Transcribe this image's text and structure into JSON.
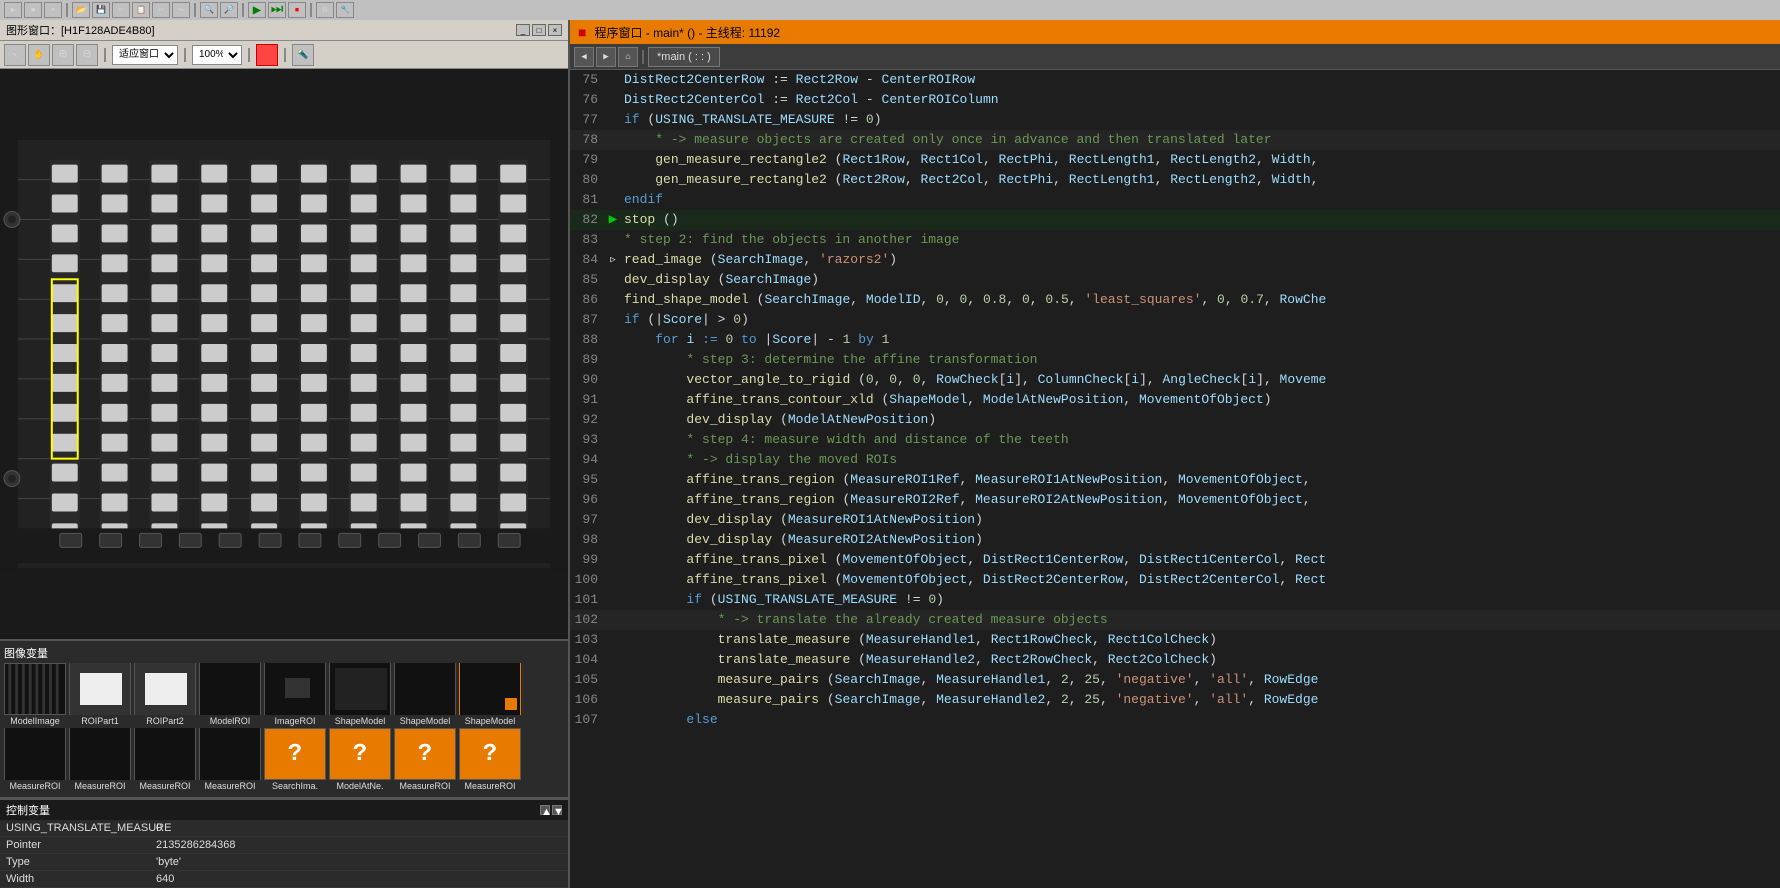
{
  "topToolbar": {
    "icons": [
      "▶",
      "⏹",
      "⏸",
      "📁",
      "💾",
      "✂",
      "📋",
      "↩",
      "↪",
      "🔍",
      "🔎",
      "⚙",
      "🔧"
    ]
  },
  "leftPanel": {
    "title": "图形窗口：[H1F128ADE4B80]",
    "toolbar": {
      "zoomLabel": "适应窗口",
      "zoomPercent": "100%"
    },
    "thumbnailSection": {
      "label": "图像变量",
      "row1": [
        {
          "label": "ModelImage",
          "type": "striped"
        },
        {
          "label": "ROIPart1",
          "type": "white"
        },
        {
          "label": "ROIPart2",
          "type": "white"
        },
        {
          "label": "ModelROI",
          "type": "dark"
        },
        {
          "label": "ImageROI",
          "type": "dark"
        },
        {
          "label": "ShapeModel",
          "type": "dark"
        },
        {
          "label": "ShapeModel",
          "type": "dark"
        },
        {
          "label": "ShapeModel",
          "type": "dark-orange"
        }
      ],
      "row2": [
        {
          "label": "MeasureROI",
          "type": "dark"
        },
        {
          "label": "MeasureROI",
          "type": "dark"
        },
        {
          "label": "MeasureROI",
          "type": "dark"
        },
        {
          "label": "MeasureROI",
          "type": "dark"
        },
        {
          "label": "SearchIma.",
          "type": "question"
        },
        {
          "label": "ModelAtNe.",
          "type": "question"
        },
        {
          "label": "MeasureROI",
          "type": "question"
        },
        {
          "label": "MeasureROI",
          "type": "question"
        }
      ]
    },
    "variablesSection": {
      "label": "控制变量",
      "rows": [
        {
          "name": "USING_TRANSLATE_MEASURE",
          "value": "0"
        },
        {
          "name": "Pointer",
          "value": "2135286284368"
        },
        {
          "name": "Type",
          "value": "'byte'"
        },
        {
          "name": "Width",
          "value": "640"
        }
      ]
    }
  },
  "rightPanel": {
    "title": "程序窗口 - main* () - 主线程: 11192",
    "breadcrumb": "*main ( : : )",
    "lines": [
      {
        "num": 75,
        "indent": 0,
        "content": "DistRect2CenterRow := Rect2Row - CenterROIRow",
        "indicator": ""
      },
      {
        "num": 76,
        "indent": 0,
        "content": "DistRect2CenterCol := Rect2Col - CenterROIColumn",
        "indicator": ""
      },
      {
        "num": 77,
        "indent": 0,
        "content": "if (USING_TRANSLATE_MEASURE != 0)",
        "indicator": ""
      },
      {
        "num": 78,
        "indent": 1,
        "content": "* -> measure objects are created only once in advance and then translated later",
        "indicator": "",
        "isComment": true
      },
      {
        "num": 79,
        "indent": 1,
        "content": "gen_measure_rectangle2 (Rect1Row, Rect1Col, RectPhi, RectLength1, RectLength2, Width,",
        "indicator": ""
      },
      {
        "num": 80,
        "indent": 1,
        "content": "gen_measure_rectangle2 (Rect2Row, Rect2Col, RectPhi, RectLength1, RectLength2, Width,",
        "indicator": ""
      },
      {
        "num": 81,
        "indent": 0,
        "content": "endif",
        "indicator": ""
      },
      {
        "num": 82,
        "indent": 0,
        "content": "stop ()",
        "indicator": "green-arrow"
      },
      {
        "num": 83,
        "indent": 0,
        "content": "* step 2: find the objects in another image",
        "indicator": "",
        "isComment": true
      },
      {
        "num": 84,
        "indent": 0,
        "content": "read_image (SearchImage, 'razors2')",
        "indicator": "",
        "hasCursor": true
      },
      {
        "num": 85,
        "indent": 0,
        "content": "dev_display (SearchImage)",
        "indicator": ""
      },
      {
        "num": 86,
        "indent": 0,
        "content": "find_shape_model (SearchImage, ModelID, 0, 0, 0.8, 0, 0.5, 'least_squares', 0, 0.7, RowChe",
        "indicator": ""
      },
      {
        "num": 87,
        "indent": 0,
        "content": "if (|Score| > 0)",
        "indicator": ""
      },
      {
        "num": 88,
        "indent": 1,
        "content": "for i := 0 to |Score| - 1 by 1",
        "indicator": ""
      },
      {
        "num": 89,
        "indent": 2,
        "content": "* step 3: determine the affine transformation",
        "indicator": "",
        "isComment": true
      },
      {
        "num": 90,
        "indent": 2,
        "content": "vector_angle_to_rigid (0, 0, 0, RowCheck[i], ColumnCheck[i], AngleCheck[i], Moveme",
        "indicator": ""
      },
      {
        "num": 91,
        "indent": 2,
        "content": "affine_trans_contour_xld (ShapeModel, ModelAtNewPosition, MovementOfObject)",
        "indicator": ""
      },
      {
        "num": 92,
        "indent": 2,
        "content": "dev_display (ModelAtNewPosition)",
        "indicator": ""
      },
      {
        "num": 93,
        "indent": 2,
        "content": "* step 4: measure width and distance of the teeth",
        "indicator": "",
        "isComment": true
      },
      {
        "num": 94,
        "indent": 2,
        "content": "* -> display the moved ROIs",
        "indicator": "",
        "isComment": true
      },
      {
        "num": 95,
        "indent": 2,
        "content": "affine_trans_region (MeasureROI1Ref, MeasureROI1AtNewPosition, MovementOfObject,",
        "indicator": ""
      },
      {
        "num": 96,
        "indent": 2,
        "content": "affine_trans_region (MeasureROI2Ref, MeasureROI2AtNewPosition, MovementOfObject,",
        "indicator": ""
      },
      {
        "num": 97,
        "indent": 2,
        "content": "dev_display (MeasureROI1AtNewPosition)",
        "indicator": ""
      },
      {
        "num": 98,
        "indent": 2,
        "content": "dev_display (MeasureROI2AtNewPosition)",
        "indicator": ""
      },
      {
        "num": 99,
        "indent": 2,
        "content": "affine_trans_pixel (MovementOfObject, DistRect1CenterRow, DistRect1CenterCol, Rect",
        "indicator": ""
      },
      {
        "num": 100,
        "indent": 2,
        "content": "affine_trans_pixel (MovementOfObject, DistRect2CenterRow, DistRect2CenterCol, Rect",
        "indicator": ""
      },
      {
        "num": 101,
        "indent": 2,
        "content": "if (USING_TRANSLATE_MEASURE != 0)",
        "indicator": ""
      },
      {
        "num": 102,
        "indent": 3,
        "content": "* -> translate the already created measure objects",
        "indicator": "",
        "isComment": true
      },
      {
        "num": 103,
        "indent": 3,
        "content": "translate_measure (MeasureHandle1, Rect1RowCheck, Rect1ColCheck)",
        "indicator": ""
      },
      {
        "num": 104,
        "indent": 3,
        "content": "translate_measure (MeasureHandle2, Rect2RowCheck, Rect2ColCheck)",
        "indicator": ""
      },
      {
        "num": 105,
        "indent": 3,
        "content": "measure_pairs (SearchImage, MeasureHandle1, 2, 25, 'negative', 'all', RowEdge",
        "indicator": ""
      },
      {
        "num": 106,
        "indent": 3,
        "content": "measure_pairs (SearchImage, MeasureHandle2, 2, 25, 'negative', 'all', RowEdge",
        "indicator": ""
      },
      {
        "num": 107,
        "indent": 2,
        "content": "else",
        "indicator": ""
      }
    ]
  }
}
